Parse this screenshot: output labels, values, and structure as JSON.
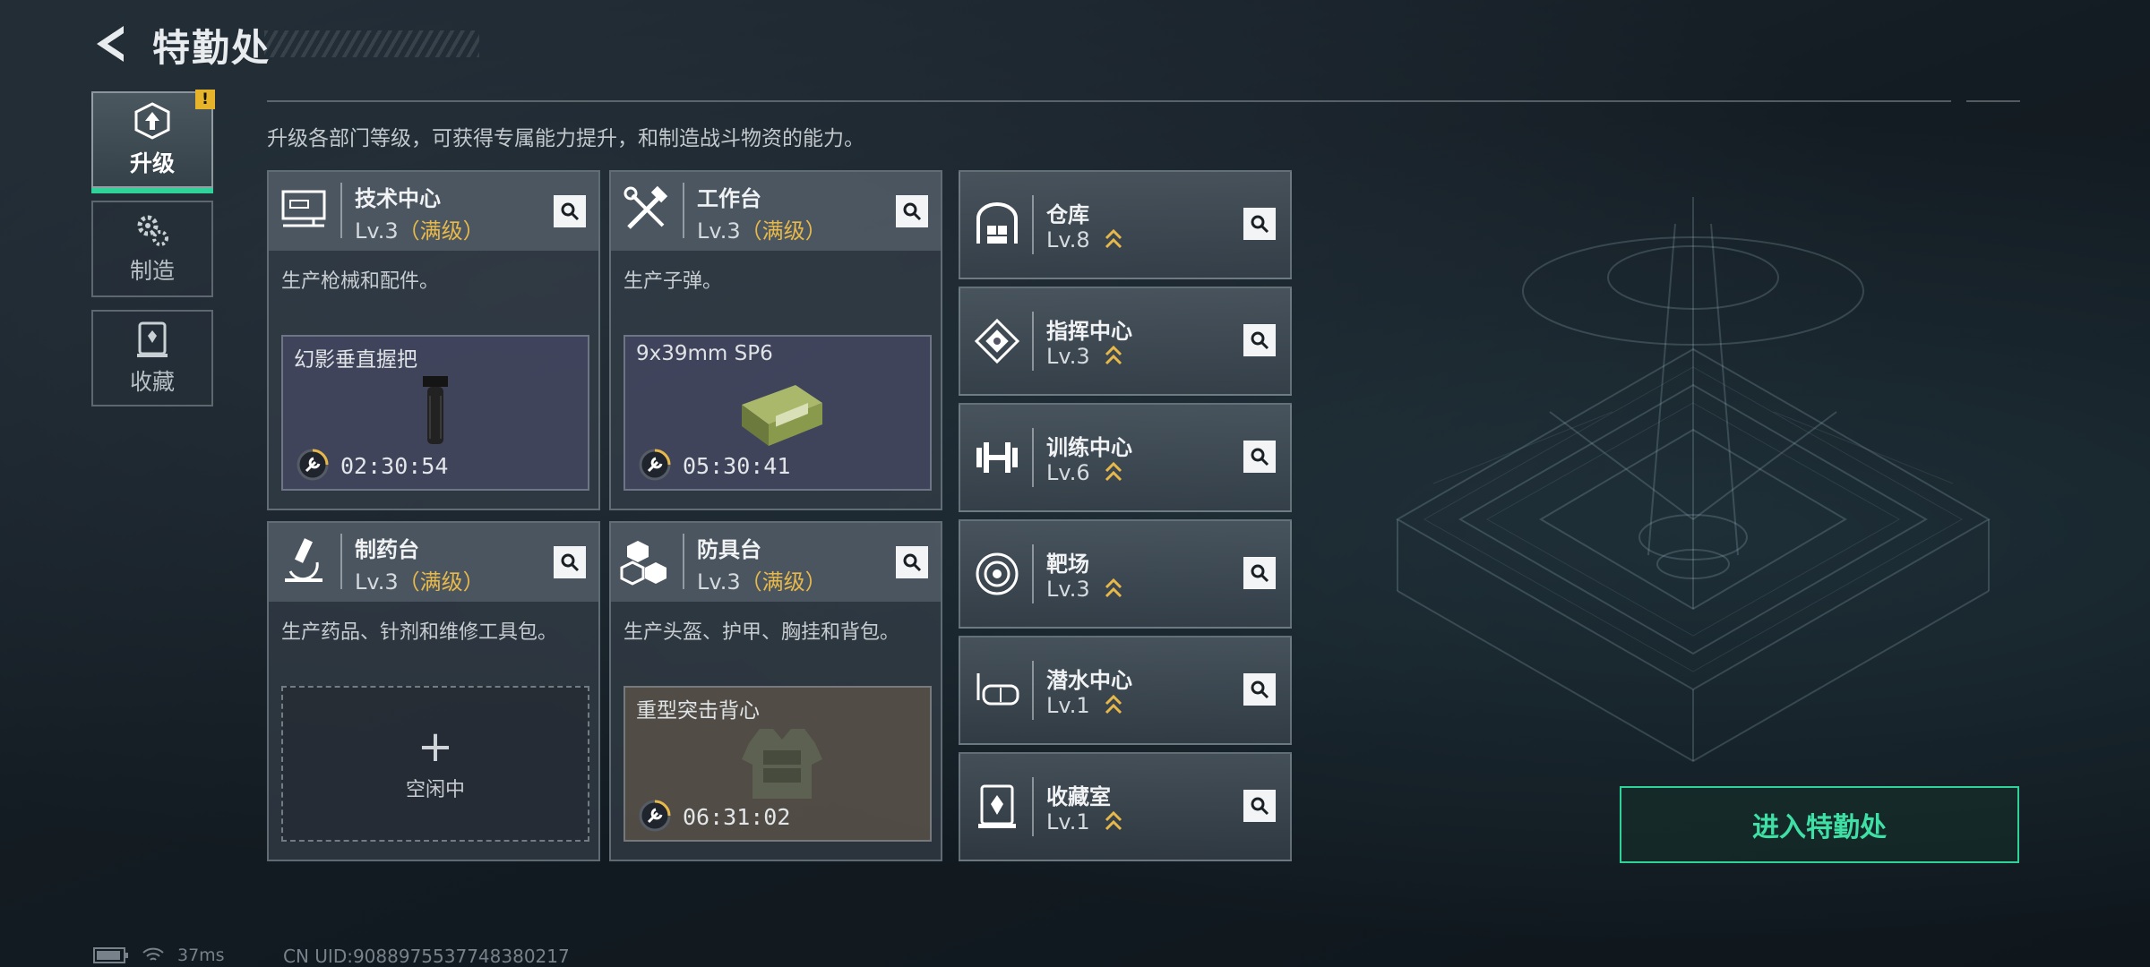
{
  "header": {
    "title": "特勤处"
  },
  "nav": [
    {
      "label": "升级",
      "icon": "upgrade-icon",
      "active": true,
      "badge": "!"
    },
    {
      "label": "制造",
      "icon": "gears-icon"
    },
    {
      "label": "收藏",
      "icon": "trophy-cabinet-icon"
    }
  ],
  "description": "升级各部门等级，可获得专属能力提升，和制造战斗物资的能力。",
  "cards": [
    {
      "name": "技术中心",
      "level": "Lv.3",
      "max": "（满级）",
      "produces": "生产枪械和配件。",
      "slot": {
        "item": "幻影垂直握把",
        "timer": "02:30:54"
      }
    },
    {
      "name": "工作台",
      "level": "Lv.3",
      "max": "（满级）",
      "produces": "生产子弹。",
      "slot": {
        "item": "9x39mm SP6",
        "timer": "05:30:41"
      }
    },
    {
      "name": "制药台",
      "level": "Lv.3",
      "max": "（满级）",
      "produces": "生产药品、针剂和维修工具包。",
      "slot": {
        "empty_label": "空闲中"
      }
    },
    {
      "name": "防具台",
      "level": "Lv.3",
      "max": "（满级）",
      "produces": "生产头盔、护甲、胸挂和背包。",
      "slot": {
        "item": "重型突击背心",
        "timer": "06:31:02"
      }
    }
  ],
  "rooms": [
    {
      "name": "仓库",
      "level": "Lv.8"
    },
    {
      "name": "指挥中心",
      "level": "Lv.3"
    },
    {
      "name": "训练中心",
      "level": "Lv.6"
    },
    {
      "name": "靶场",
      "level": "Lv.3"
    },
    {
      "name": "潜水中心",
      "level": "Lv.1"
    },
    {
      "name": "收藏室",
      "level": "Lv.1"
    }
  ],
  "enter_button": "进入特勤处",
  "status": {
    "ping": "37ms",
    "uid": "CN UID:9088975537748380217"
  },
  "colors": {
    "accent": "#2fd39a",
    "max_level": "#e7b84a",
    "badge": "#e5b42a"
  }
}
